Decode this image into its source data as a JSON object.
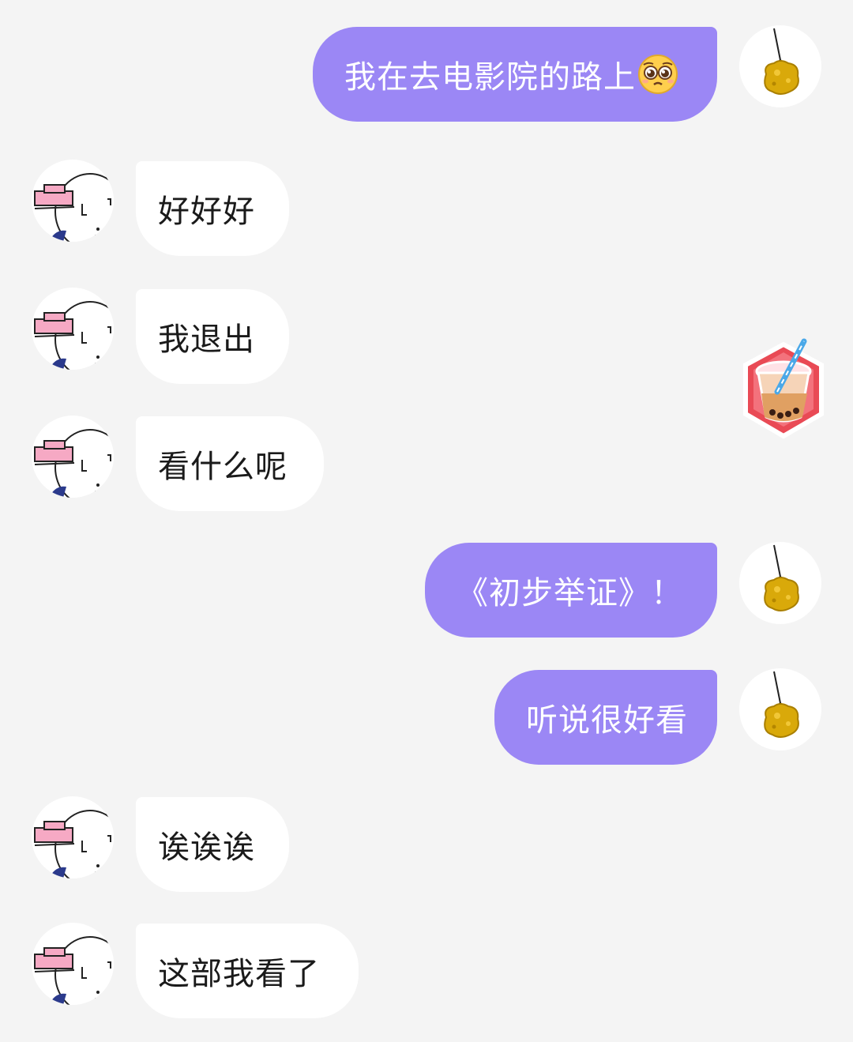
{
  "messages": [
    {
      "side": "out",
      "text": "我在去电影院的路上",
      "emoji": "pleading-face-emoji"
    },
    {
      "side": "in",
      "text": "好好好"
    },
    {
      "side": "in",
      "text": "我退出"
    },
    {
      "side": "out",
      "sticker": "bubble-tea-sticker"
    },
    {
      "side": "in",
      "text": "看什么呢"
    },
    {
      "side": "out",
      "text": "《初步举证》！"
    },
    {
      "side": "out",
      "text": "听说很好看"
    },
    {
      "side": "in",
      "text": "诶诶诶"
    },
    {
      "side": "in",
      "text": "这部我看了"
    }
  ],
  "colors": {
    "background": "#f4f4f4",
    "outgoing_bubble": "#9b87f5",
    "incoming_bubble": "#ffffff",
    "outgoing_text": "#ffffff",
    "incoming_text": "#1a1a1a"
  },
  "icons": {
    "self_avatar": "golden-nugget-on-string-avatar",
    "other_avatar": "cartoon-face-with-pink-hat-avatar"
  }
}
